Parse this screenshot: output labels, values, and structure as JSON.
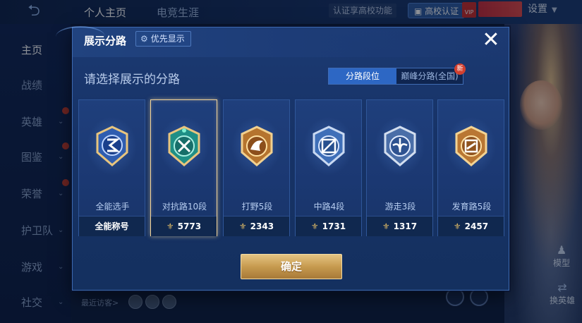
{
  "background": {
    "back_icon": "back-arrow-icon",
    "tabs": [
      {
        "label": "个人主页"
      },
      {
        "label": "电竞生涯"
      }
    ],
    "verify_tip": "认证享高校功能",
    "verify_button": "高校认证",
    "vip_badge": "VIP",
    "settings": "设置",
    "side_nav": [
      {
        "label": "主页"
      },
      {
        "label": "战绩"
      },
      {
        "label": "英雄"
      },
      {
        "label": "图鉴"
      },
      {
        "label": "荣誉"
      },
      {
        "label": "护卫队"
      },
      {
        "label": "游戏"
      },
      {
        "label": "社交"
      }
    ],
    "model_button": "模型",
    "swap_button": "换英雄",
    "recent_visitors": "最近访客>"
  },
  "modal": {
    "title": "展示分路",
    "priority_button": "优先显示",
    "subtitle": "请选择展示的分路",
    "segments": [
      {
        "label": "分路段位",
        "active": true
      },
      {
        "label": "巅峰分路(全国)",
        "active": false
      }
    ],
    "new_badge": "新",
    "cards": [
      {
        "icon": "all-round-badge-icon",
        "name": "全能选手",
        "value": "全能称号",
        "show_power_icon": false,
        "selected": false
      },
      {
        "icon": "clash-lane-badge-icon",
        "name": "对抗路10段",
        "value": "5773",
        "show_power_icon": true,
        "selected": true
      },
      {
        "icon": "jungle-badge-icon",
        "name": "打野5段",
        "value": "2343",
        "show_power_icon": true,
        "selected": false
      },
      {
        "icon": "mid-lane-badge-icon",
        "name": "中路4段",
        "value": "1731",
        "show_power_icon": true,
        "selected": false
      },
      {
        "icon": "roam-badge-icon",
        "name": "游走3段",
        "value": "1317",
        "show_power_icon": true,
        "selected": false
      },
      {
        "icon": "farm-lane-badge-icon",
        "name": "发育路5段",
        "value": "2457",
        "show_power_icon": true,
        "selected": false
      }
    ],
    "confirm_button": "确定"
  },
  "colors": {
    "accent_blue": "#2d67c4",
    "gold": "#d6b465",
    "selected_border": "#f2d49a"
  }
}
